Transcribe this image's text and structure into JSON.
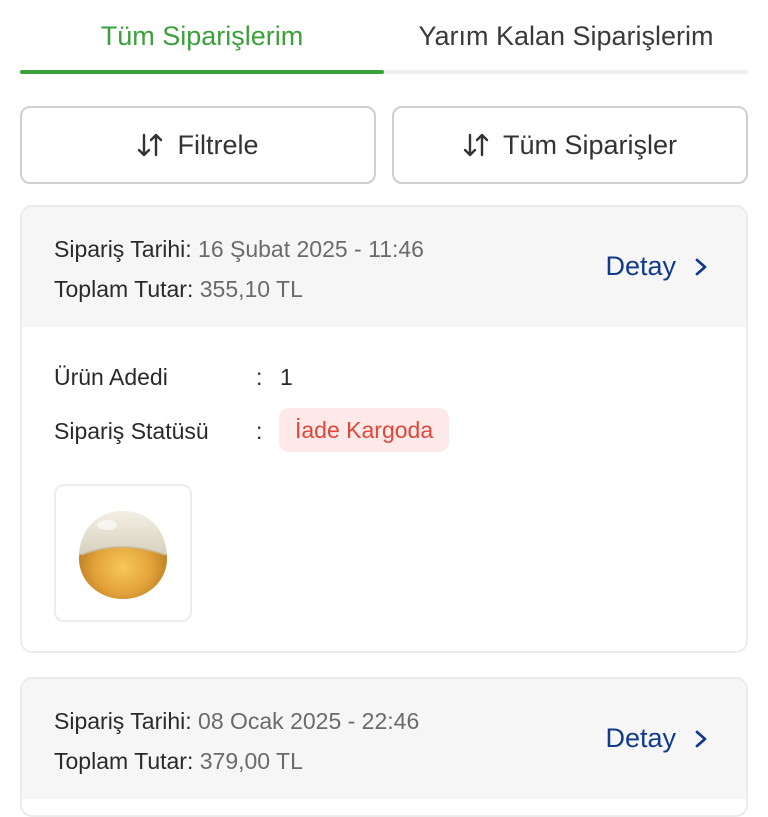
{
  "tabs": {
    "all": "Tüm Siparişlerim",
    "incomplete": "Yarım Kalan Siparişlerim"
  },
  "actions": {
    "filter": "Filtrele",
    "all_orders": "Tüm Siparişler"
  },
  "colors": {
    "accent_green": "#3aa13a",
    "link_blue": "#123a8c",
    "status_red": "#e0473c",
    "status_bg": "#fde9e7"
  },
  "orders": [
    {
      "date_label": "Sipariş Tarihi:",
      "date_value": "16 Şubat 2025 - 11:46",
      "total_label": "Toplam Tutar:",
      "total_value": "355,10 TL",
      "detail_label": "Detay",
      "count_label": "Ürün Adedi",
      "count_value": "1",
      "status_label": "Sipariş Statüsü",
      "status_value": "İade Kargoda",
      "colon": ":",
      "product_icon": "perfume-bottle"
    },
    {
      "date_label": "Sipariş Tarihi:",
      "date_value": "08 Ocak 2025 - 22:46",
      "total_label": "Toplam Tutar:",
      "total_value": "379,00 TL",
      "detail_label": "Detay"
    }
  ]
}
